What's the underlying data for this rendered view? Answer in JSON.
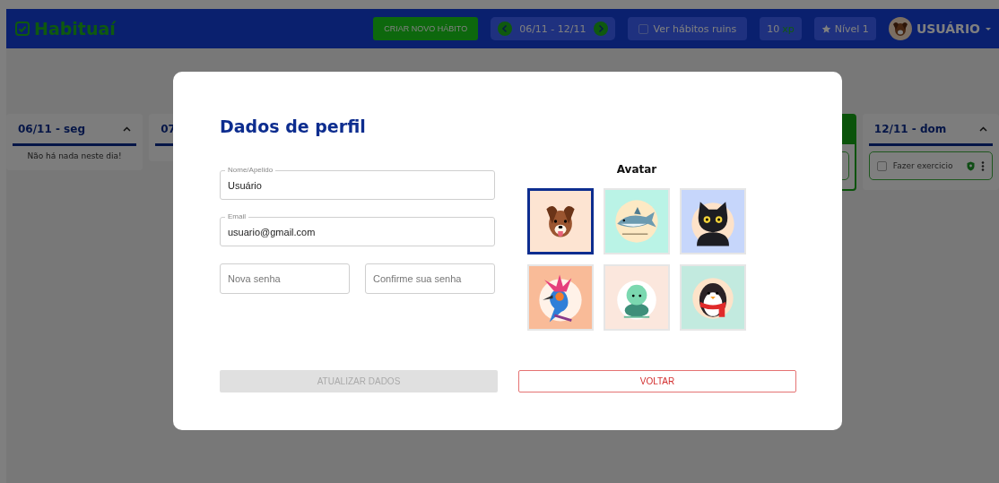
{
  "header": {
    "logo": "Habituaí",
    "new_habit_button": "CRIAR NOVO HÁBITO",
    "week_range": "06/11 - 12/11",
    "bad_habits": {
      "label": "Ver hábitos ruins",
      "checked": false
    },
    "xp": {
      "value": "10",
      "unit": "xp"
    },
    "level": "Nível 1",
    "user": "USUÁRIO"
  },
  "days": [
    {
      "title": "06/11 - seg",
      "selected": false,
      "expanded": true,
      "empty_text": "Não há nada neste dia!"
    },
    {
      "title": "07",
      "selected": false
    },
    {
      "selected": true,
      "expanded": true,
      "items": [
        {
          "kind": "hidden"
        }
      ]
    },
    {
      "title": "12/11 - dom",
      "selected": false,
      "expanded": true,
      "items": [
        {
          "kind": "habit",
          "label": "Fazer exercicio",
          "checked": false
        }
      ]
    }
  ],
  "modal": {
    "title": "Dados de perfil",
    "fields": [
      {
        "label": "Nome/Apelido",
        "value": "Usuário"
      },
      {
        "label": "Email",
        "value": "usuario@gmail.com"
      },
      {
        "placeholder": "Nova senha"
      },
      {
        "placeholder": "Confirme sua senha"
      }
    ],
    "avatar_title": "Avatar",
    "avatars": [
      {
        "kind": "dog",
        "color": "#fde4d2",
        "selected": true
      },
      {
        "kind": "shark",
        "color": "#baf3e6",
        "selected": false
      },
      {
        "kind": "cat",
        "color": "#c6d6fb",
        "selected": false
      },
      {
        "kind": "bird",
        "color": "#f9bb98",
        "selected": false
      },
      {
        "kind": "turtle",
        "color": "#fbe7dd",
        "selected": false
      },
      {
        "kind": "penguin",
        "color": "#c2eadf",
        "selected": false
      }
    ],
    "buttons": [
      {
        "label": "ATUALIZAR DADOS",
        "kind": "primary",
        "disabled": true
      },
      {
        "label": "VOLTAR",
        "kind": "danger",
        "disabled": false
      }
    ]
  }
}
